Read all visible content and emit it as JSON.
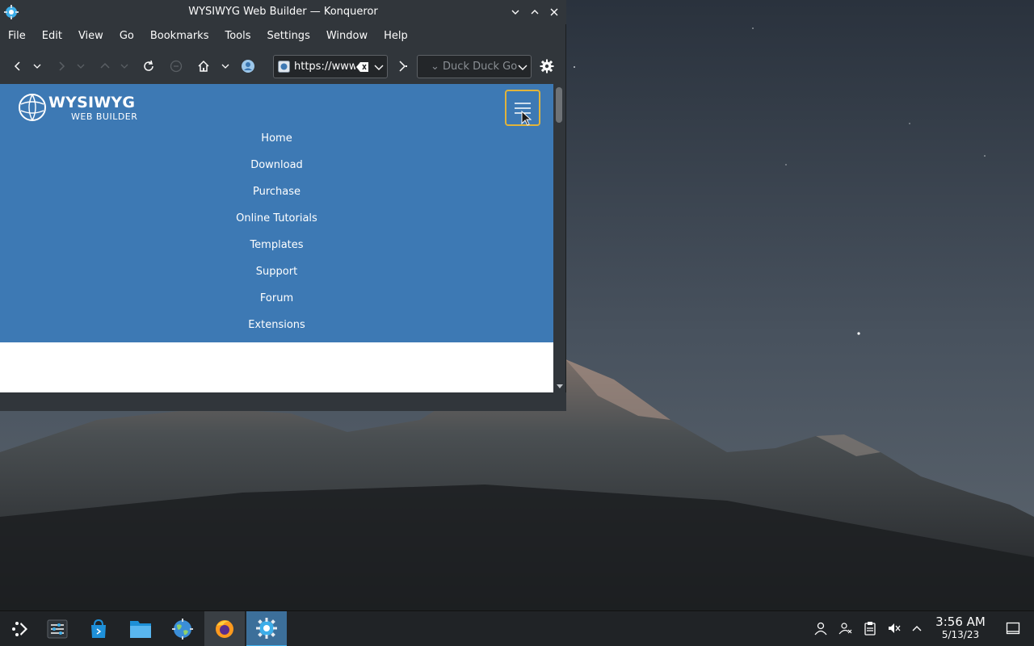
{
  "window": {
    "title": "WYSIWYG Web Builder — Konqueror"
  },
  "menubar": {
    "items": [
      "File",
      "Edit",
      "View",
      "Go",
      "Bookmarks",
      "Tools",
      "Settings",
      "Window",
      "Help"
    ]
  },
  "toolbar": {
    "url_value": "https://www.wysiwygwebbuilder.com",
    "search_placeholder": "Duck Duck Go",
    "search_prefix": "⌄"
  },
  "site": {
    "logo_word1": "WYSIWYG",
    "logo_word2": "WEB BUILDER",
    "nav_items": [
      "Home",
      "Download",
      "Purchase",
      "Online Tutorials",
      "Templates",
      "Support",
      "Forum",
      "Extensions"
    ]
  },
  "taskbar": {
    "time": "3:56 AM",
    "date": "5/13/23"
  },
  "colors": {
    "site_nav_bg": "#3d79b4",
    "focus_ring": "#e1b43b",
    "accent": "#3daee9"
  }
}
